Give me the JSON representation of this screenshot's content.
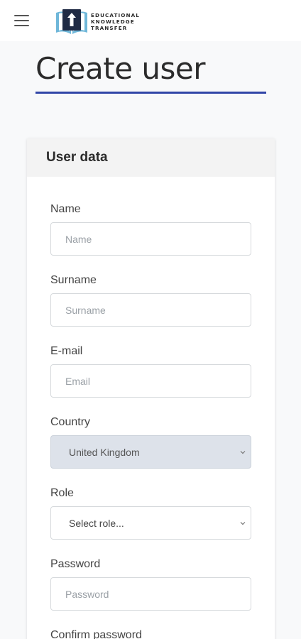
{
  "header": {
    "logo_lines": [
      "EDUCATIONAL",
      "KNOWLEDGE",
      "TRANSFER"
    ]
  },
  "page": {
    "title": "Create user"
  },
  "card": {
    "title": "User data"
  },
  "form": {
    "name": {
      "label": "Name",
      "placeholder": "Name"
    },
    "surname": {
      "label": "Surname",
      "placeholder": "Surname"
    },
    "email": {
      "label": "E-mail",
      "placeholder": "Email"
    },
    "country": {
      "label": "Country",
      "value": "United Kingdom"
    },
    "role": {
      "label": "Role",
      "value": "Select role..."
    },
    "password": {
      "label": "Password",
      "placeholder": "Password"
    },
    "confirm_password": {
      "label": "Confirm password"
    }
  },
  "colors": {
    "accent_underline": "#3145a7",
    "disabled_select_bg": "#dde2ea"
  }
}
